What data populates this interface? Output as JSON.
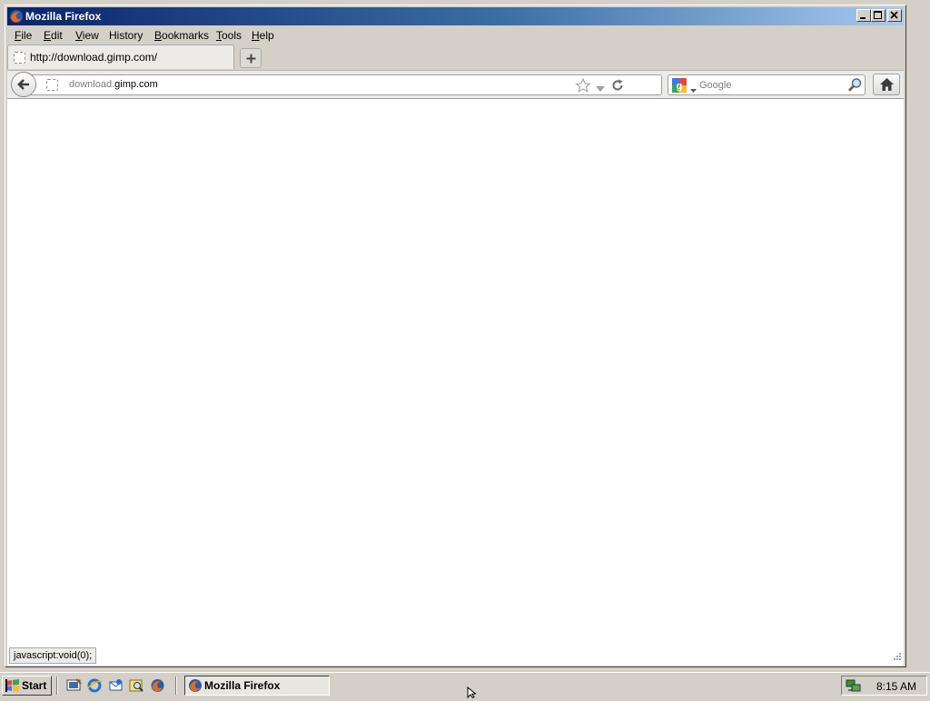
{
  "window": {
    "title": "Mozilla Firefox"
  },
  "menubar": {
    "items": [
      {
        "label": "File",
        "accel": "F",
        "rest": "ile"
      },
      {
        "label": "Edit",
        "accel": "E",
        "rest": "dit"
      },
      {
        "label": "View",
        "accel": "V",
        "rest": "iew"
      },
      {
        "label": "History",
        "accel": "",
        "rest": "History"
      },
      {
        "label": "Bookmarks",
        "accel": "B",
        "rest": "ookmarks"
      },
      {
        "label": "Tools",
        "accel": "T",
        "rest": "ools"
      },
      {
        "label": "Help",
        "accel": "H",
        "rest": "elp"
      }
    ]
  },
  "tabs": [
    {
      "label": "http://download.gimp.com/",
      "selected": true
    }
  ],
  "navbar": {
    "url_prefix": "download.",
    "url_domain": "gimp.com",
    "search_placeholder": "Google",
    "search_value": ""
  },
  "status": {
    "text": "javascript:void(0);"
  },
  "taskbar": {
    "start_label": "Start",
    "tasks": [
      {
        "label": "Mozilla Firefox"
      }
    ],
    "clock": "8:15 AM"
  },
  "colors": {
    "titlebar_start": "#0a246a",
    "titlebar_end": "#a6caf0",
    "chrome": "#d4d0c8"
  }
}
